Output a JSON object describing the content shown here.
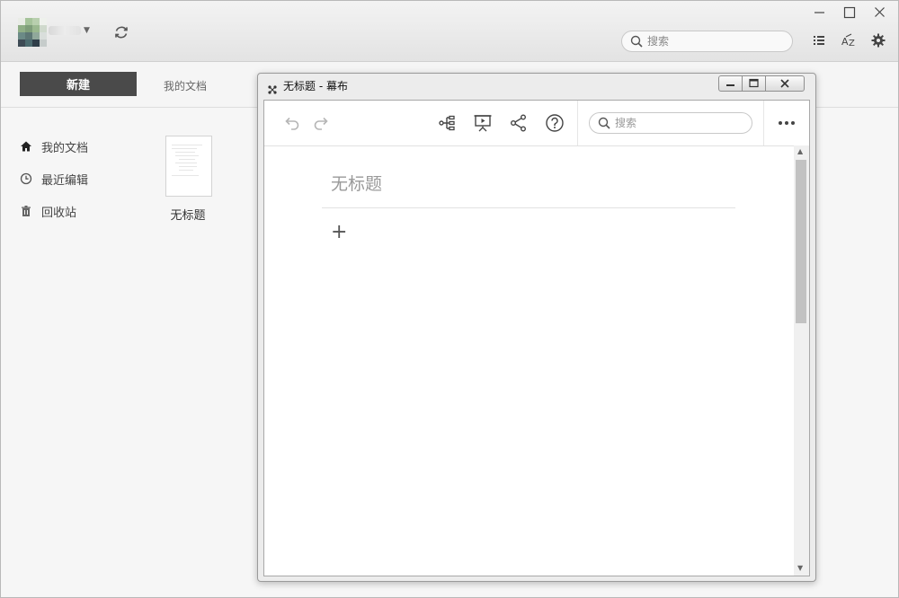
{
  "app": {
    "search_placeholder": "搜索",
    "new_button": "新建",
    "breadcrumb": "我的文档",
    "sidebar": [
      {
        "label": "我的文档",
        "icon": "home-icon"
      },
      {
        "label": "最近编辑",
        "icon": "clock-icon"
      },
      {
        "label": "回收站",
        "icon": "trash-icon"
      }
    ],
    "documents": [
      {
        "name": "无标题"
      }
    ],
    "toolbar_icons": [
      "list-view-icon",
      "sort-az-icon",
      "settings-gear-icon"
    ],
    "window_controls": [
      "minimize-icon",
      "maximize-icon",
      "close-icon"
    ]
  },
  "editor_window": {
    "title": "无标题 - 幕布",
    "search_placeholder": "搜索",
    "doc_title_placeholder": "无标题",
    "add_node": "+",
    "toolbar_icons": [
      "undo-icon",
      "redo-icon",
      "mindmap-icon",
      "presentation-icon",
      "share-icon",
      "help-icon",
      "more-icon"
    ]
  },
  "colors": {
    "primary_button": "#4a4a4a",
    "avatar": [
      "#7f9e7a",
      "#a5c39a",
      "#3e4b55",
      "#6b8a86"
    ]
  }
}
